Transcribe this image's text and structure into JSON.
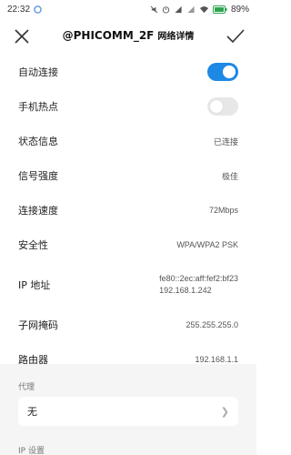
{
  "status_bar": {
    "time": "22:32",
    "battery": "89%"
  },
  "header": {
    "title": "@PHICOMM_2F",
    "subtitle": "网络详情"
  },
  "rows": {
    "auto_connect": {
      "label": "自动连接",
      "on": true
    },
    "hotspot": {
      "label": "手机热点",
      "on": false
    },
    "status": {
      "label": "状态信息",
      "value": "已连接"
    },
    "signal": {
      "label": "信号强度",
      "value": "极佳"
    },
    "speed": {
      "label": "连接速度",
      "value": "72Mbps"
    },
    "security": {
      "label": "安全性",
      "value": "WPA/WPA2 PSK"
    },
    "ip": {
      "label": "IP 地址",
      "value_line1": "fe80::2ec:aff:fef2:bf23",
      "value_line2": "192.168.1.242"
    },
    "subnet": {
      "label": "子网掩码",
      "value": "255.255.255.0"
    },
    "router": {
      "label": "路由器",
      "value": "192.168.1.1"
    }
  },
  "proxy": {
    "label": "代理",
    "value": "无"
  },
  "ip_settings": {
    "label": "IP 设置"
  },
  "colors": {
    "accent": "#1e88e5",
    "section_bg": "#f5f5f5"
  }
}
